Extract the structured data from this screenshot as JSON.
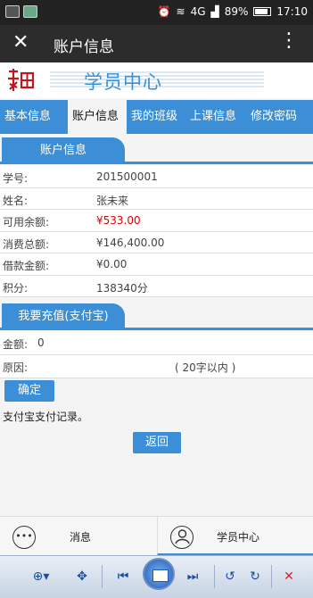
{
  "status_bar": {
    "battery": "89%",
    "time": "17:10",
    "network": "4G"
  },
  "title_bar": {
    "title": "账户信息"
  },
  "banner": {
    "title": "学员中心"
  },
  "tabs": [
    {
      "label": "基本信息"
    },
    {
      "label": "账户信息"
    },
    {
      "label": "我的班级"
    },
    {
      "label": "上课信息"
    },
    {
      "label": "修改密码"
    }
  ],
  "account": {
    "section_title": "账户信息",
    "rows": [
      {
        "label": "学号:",
        "value": "201500001"
      },
      {
        "label": "姓名:",
        "value": "张未来"
      },
      {
        "label": "可用余额:",
        "value": "¥533.00"
      },
      {
        "label": "消费总额:",
        "value": "¥146,400.00"
      },
      {
        "label": "借款金额:",
        "value": "¥0.00"
      },
      {
        "label": "积分:",
        "value": "138340分"
      }
    ]
  },
  "recharge": {
    "section_title": "我要充值(支付宝)",
    "amount_label": "金额:",
    "amount_value": "0",
    "reason_label": "原因:",
    "reason_hint": "( 20字以内 )",
    "confirm_label": "确定",
    "record_link": "支付宝支付记录。",
    "back_label": "返回"
  },
  "bottom_nav": [
    {
      "label": "消息",
      "icon": "chat-bubble-icon"
    },
    {
      "label": "学员中心",
      "icon": "person-icon"
    }
  ],
  "colors": {
    "accent": "#3c8fd6",
    "negative_value": "#dd0000"
  }
}
